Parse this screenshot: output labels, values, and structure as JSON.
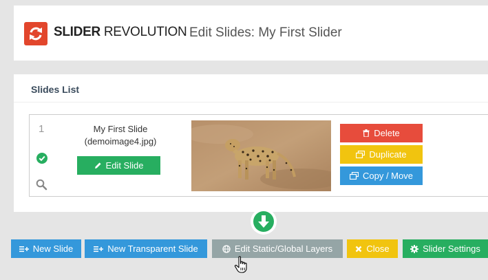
{
  "header": {
    "logo_bold": "SLIDER",
    "logo_light": "REVOLUTION",
    "title": "Edit Slides: My First Slider",
    "colors": {
      "logo": "#e2462c"
    }
  },
  "panel": {
    "title": "Slides List"
  },
  "slide": {
    "number": "1",
    "name": "My First Slide",
    "file": "(demoimage4.jpg)",
    "edit_label": "Edit Slide",
    "delete_label": "Delete",
    "duplicate_label": "Duplicate",
    "copy_move_label": "Copy / Move"
  },
  "toolbar": {
    "new_slide": "New Slide",
    "new_transparent": "New Transparent Slide",
    "edit_static": "Edit Static/Global Layers",
    "close": "Close",
    "slider_settings": "Slider Settings"
  },
  "icons": {
    "logo": "refresh-icon",
    "check": "check-circle-icon",
    "magnifier": "search-icon",
    "edit": "pencil-icon",
    "delete": "trash-icon",
    "duplicate": "duplicate-icon",
    "copy": "copy-icon",
    "new_slide": "add-list-icon",
    "static": "globe-icon",
    "close": "close-icon",
    "settings": "gear-icon",
    "down": "arrow-down-icon",
    "cursor": "hand-cursor-icon"
  },
  "colors": {
    "green": "#27ae60",
    "red": "#e74c3c",
    "yellow": "#f1c40f",
    "blue": "#3498db",
    "gray": "#95a5a6"
  }
}
